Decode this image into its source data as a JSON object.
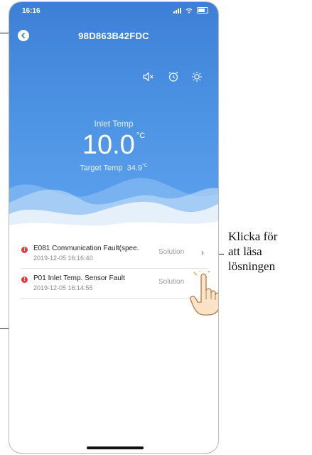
{
  "status_bar": {
    "time": "16:16"
  },
  "header": {
    "device_id": "98D863B42FDC"
  },
  "toolbar": {
    "icons": [
      "mute-icon",
      "alarm-clock-icon",
      "brightness-icon"
    ]
  },
  "temperature": {
    "inlet_label": "Inlet Temp",
    "inlet_value": "10.0",
    "unit": "°C",
    "target_label": "Target Temp",
    "target_value": "34.9"
  },
  "faults": [
    {
      "title": "E081 Communication Fault(spee...",
      "date": "2019-12-05 16:16:40",
      "action": "Solution"
    },
    {
      "title": "P01 Inlet Temp. Sensor Fault",
      "date": "2019-12-05 16:14:55",
      "action": "Solution"
    }
  ],
  "annotation": {
    "line1": "Klicka för",
    "line2": "att läsa",
    "line3": "lösningen"
  },
  "colors": {
    "primary": "#4a8ee0",
    "fault": "#e9393a"
  }
}
